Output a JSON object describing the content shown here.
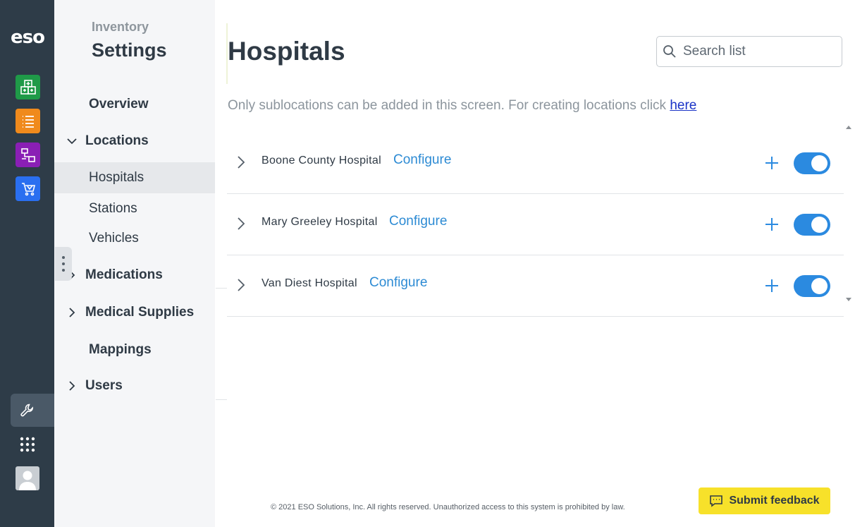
{
  "rail": {
    "logo": "eso",
    "apps": [
      {
        "icon": "hospital-grid-icon",
        "color": "#1f9a48"
      },
      {
        "icon": "list-icon",
        "color": "#f08a1c"
      },
      {
        "icon": "workflow-icon",
        "color": "#8a1fb5"
      },
      {
        "icon": "cart-icon",
        "color": "#2a6ff0"
      }
    ],
    "bottom": [
      "wrench-icon",
      "app-grid-icon",
      "avatar"
    ]
  },
  "sidebar": {
    "subtitle": "Inventory",
    "title": "Settings",
    "items": [
      {
        "label": "Overview"
      },
      {
        "label": "Locations"
      },
      {
        "label": "Hospitals"
      },
      {
        "label": "Stations"
      },
      {
        "label": "Vehicles"
      },
      {
        "label": "Medications"
      },
      {
        "label": "Medical Supplies"
      },
      {
        "label": "Mappings"
      },
      {
        "label": "Users"
      }
    ]
  },
  "main": {
    "title": "Hospitals",
    "search_placeholder": "Search list",
    "info_text": "Only sublocations can be added in this screen. For creating locations click ",
    "info_link": "here",
    "rows": [
      {
        "name": "Boone County Hospital",
        "action": "Configure",
        "enabled": true
      },
      {
        "name": "Mary Greeley Hospital",
        "action": "Configure",
        "enabled": true
      },
      {
        "name": "Van Diest Hospital",
        "action": "Configure",
        "enabled": true
      }
    ]
  },
  "footer": {
    "copyright": "© 2021 ESO Solutions, Inc. All rights reserved. Unauthorized access to this system is prohibited by law.",
    "feedback_label": "Submit feedback"
  },
  "colors": {
    "rail": "#2e3c48",
    "accent": "#2b8ae0",
    "link": "#2d8bd4",
    "feedback": "#f7e12a"
  }
}
